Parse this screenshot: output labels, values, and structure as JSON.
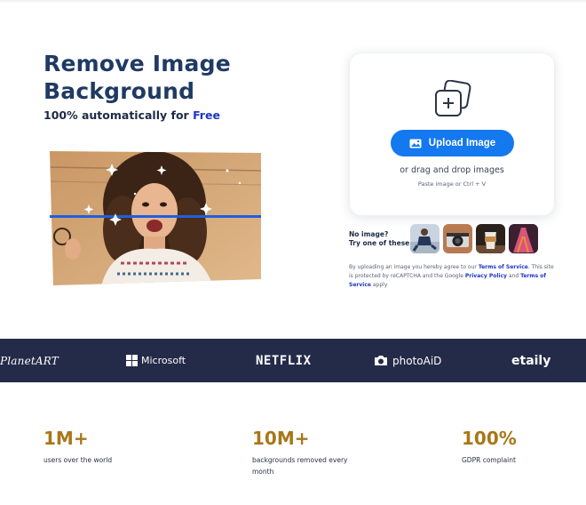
{
  "hero": {
    "title_line1": "Remove Image",
    "title_line2": "Background",
    "subtitle_prefix": "100% automatically for",
    "subtitle_highlight": "Free"
  },
  "upload": {
    "button_label": "Upload Image",
    "drag_text": "or drag and drop images",
    "paste_text": "Paste image or Ctrl + V"
  },
  "samples": {
    "label_line1": "No image?",
    "label_line2": "Try one of these:",
    "thumbnails": [
      "person-sample",
      "camera-sample",
      "coffee-cup-sample",
      "dress-sample"
    ]
  },
  "legal": {
    "text1": "By uploading an image you hereby agree to our",
    "link_terms": "Terms of Service",
    "text2": ". This site is protected by reCAPTCHA and the Google",
    "link_privacy": "Privacy Policy",
    "text3": "and",
    "link_terms2": "Terms of Service",
    "text4": "apply"
  },
  "brands": {
    "planetart": "PlanetART",
    "microsoft": "Microsoft",
    "netflix": "NETFLIX",
    "photoaid": "photoAiD",
    "etaily": "etaily"
  },
  "stats": [
    {
      "value": "1M+",
      "caption": "users over the world"
    },
    {
      "value": "10M+",
      "caption": "backgrounds removed every month"
    },
    {
      "value": "100%",
      "caption": "GDPR complaint"
    }
  ],
  "colors": {
    "accent": "#1478ef",
    "title": "#1f3a63",
    "link": "#1d35c6",
    "brand_bar": "#232b49",
    "stat_gold": "#a8771a"
  }
}
